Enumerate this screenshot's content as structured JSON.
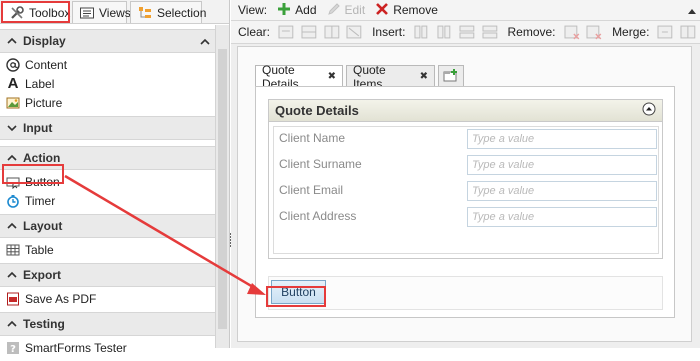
{
  "left_tabs": [
    {
      "label": "Toolbox",
      "icon": "tools-icon",
      "active": true
    },
    {
      "label": "Views",
      "icon": "views-icon",
      "active": false
    },
    {
      "label": "Selection",
      "icon": "selection-icon",
      "active": false
    }
  ],
  "sections": [
    {
      "title": "Display",
      "expanded": true,
      "items": [
        {
          "label": "Content",
          "icon": "at-sign-icon"
        },
        {
          "label": "Label",
          "icon": "label-a-icon"
        },
        {
          "label": "Picture",
          "icon": "picture-icon"
        }
      ]
    },
    {
      "title": "Input",
      "expanded": false,
      "items": []
    },
    {
      "title": "Action",
      "expanded": true,
      "items": [
        {
          "label": "Button",
          "icon": "button-icon"
        },
        {
          "label": "Timer",
          "icon": "timer-icon"
        }
      ]
    },
    {
      "title": "Layout",
      "expanded": true,
      "items": [
        {
          "label": "Table",
          "icon": "table-icon"
        }
      ]
    },
    {
      "title": "Export",
      "expanded": true,
      "items": [
        {
          "label": "Save As PDF",
          "icon": "pdf-icon"
        }
      ]
    },
    {
      "title": "Testing",
      "expanded": true,
      "items": [
        {
          "label": "SmartForms Tester",
          "icon": "question-icon"
        }
      ]
    }
  ],
  "toolbar": {
    "view_label": "View:",
    "add_label": "Add",
    "edit_label": "Edit",
    "remove_label": "Remove",
    "clear_label": "Clear:",
    "insert_label": "Insert:",
    "remove2_label": "Remove:",
    "merge_label": "Merge:"
  },
  "form_tabs": [
    {
      "label": "Quote Details",
      "active": true
    },
    {
      "label": "Quote Items",
      "active": false
    }
  ],
  "quote_details": {
    "title": "Quote Details",
    "fields": [
      {
        "label": "Client Name",
        "placeholder": "Type a value"
      },
      {
        "label": "Client Surname",
        "placeholder": "Type a value"
      },
      {
        "label": "Client Email",
        "placeholder": "Type a value"
      },
      {
        "label": "Client Address",
        "placeholder": "Type a value"
      }
    ]
  },
  "form_button_label": "Button",
  "colors": {
    "highlight": "#e53b3b",
    "add_green": "#3aa03a",
    "remove_red": "#cc2222",
    "button_blue": "#c9e0f2"
  }
}
